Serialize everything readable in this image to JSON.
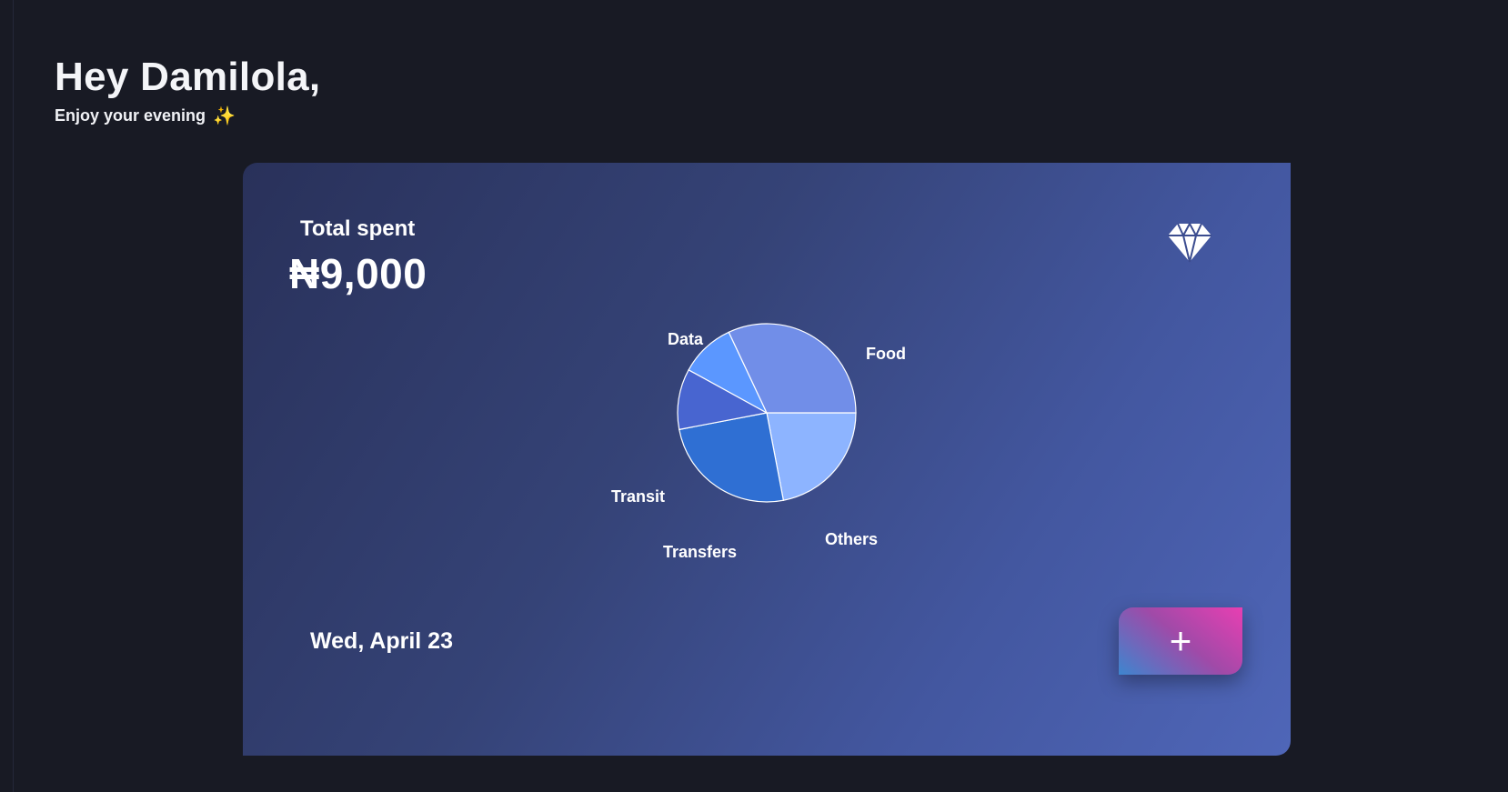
{
  "greeting": {
    "title": "Hey Damilola,",
    "subtitle": "Enjoy your evening",
    "subtitle_icon": "sparkles-icon",
    "subtitle_icon_glyph": "✨"
  },
  "summary": {
    "label": "Total spent",
    "amount": "₦9,000",
    "badge_icon": "diamond-icon"
  },
  "date": "Wed, April 23",
  "add_button": {
    "icon": "plus-icon",
    "glyph": "+"
  },
  "colors": {
    "background": "#181a24",
    "card_gradient_start": "#29315a",
    "card_gradient_end": "#4f66b8",
    "button_gradient_start": "#e83fb2",
    "button_gradient_end": "#3d86cf"
  },
  "chart_data": {
    "type": "pie",
    "title": "",
    "categories": [
      "Food",
      "Others",
      "Transfers",
      "Transit",
      "Data"
    ],
    "values": [
      22,
      25,
      11,
      10,
      32
    ],
    "colors": [
      "#8db4ff",
      "#2f6fd3",
      "#4865d0",
      "#5b97ff",
      "#718ee8"
    ],
    "legend": "none"
  }
}
